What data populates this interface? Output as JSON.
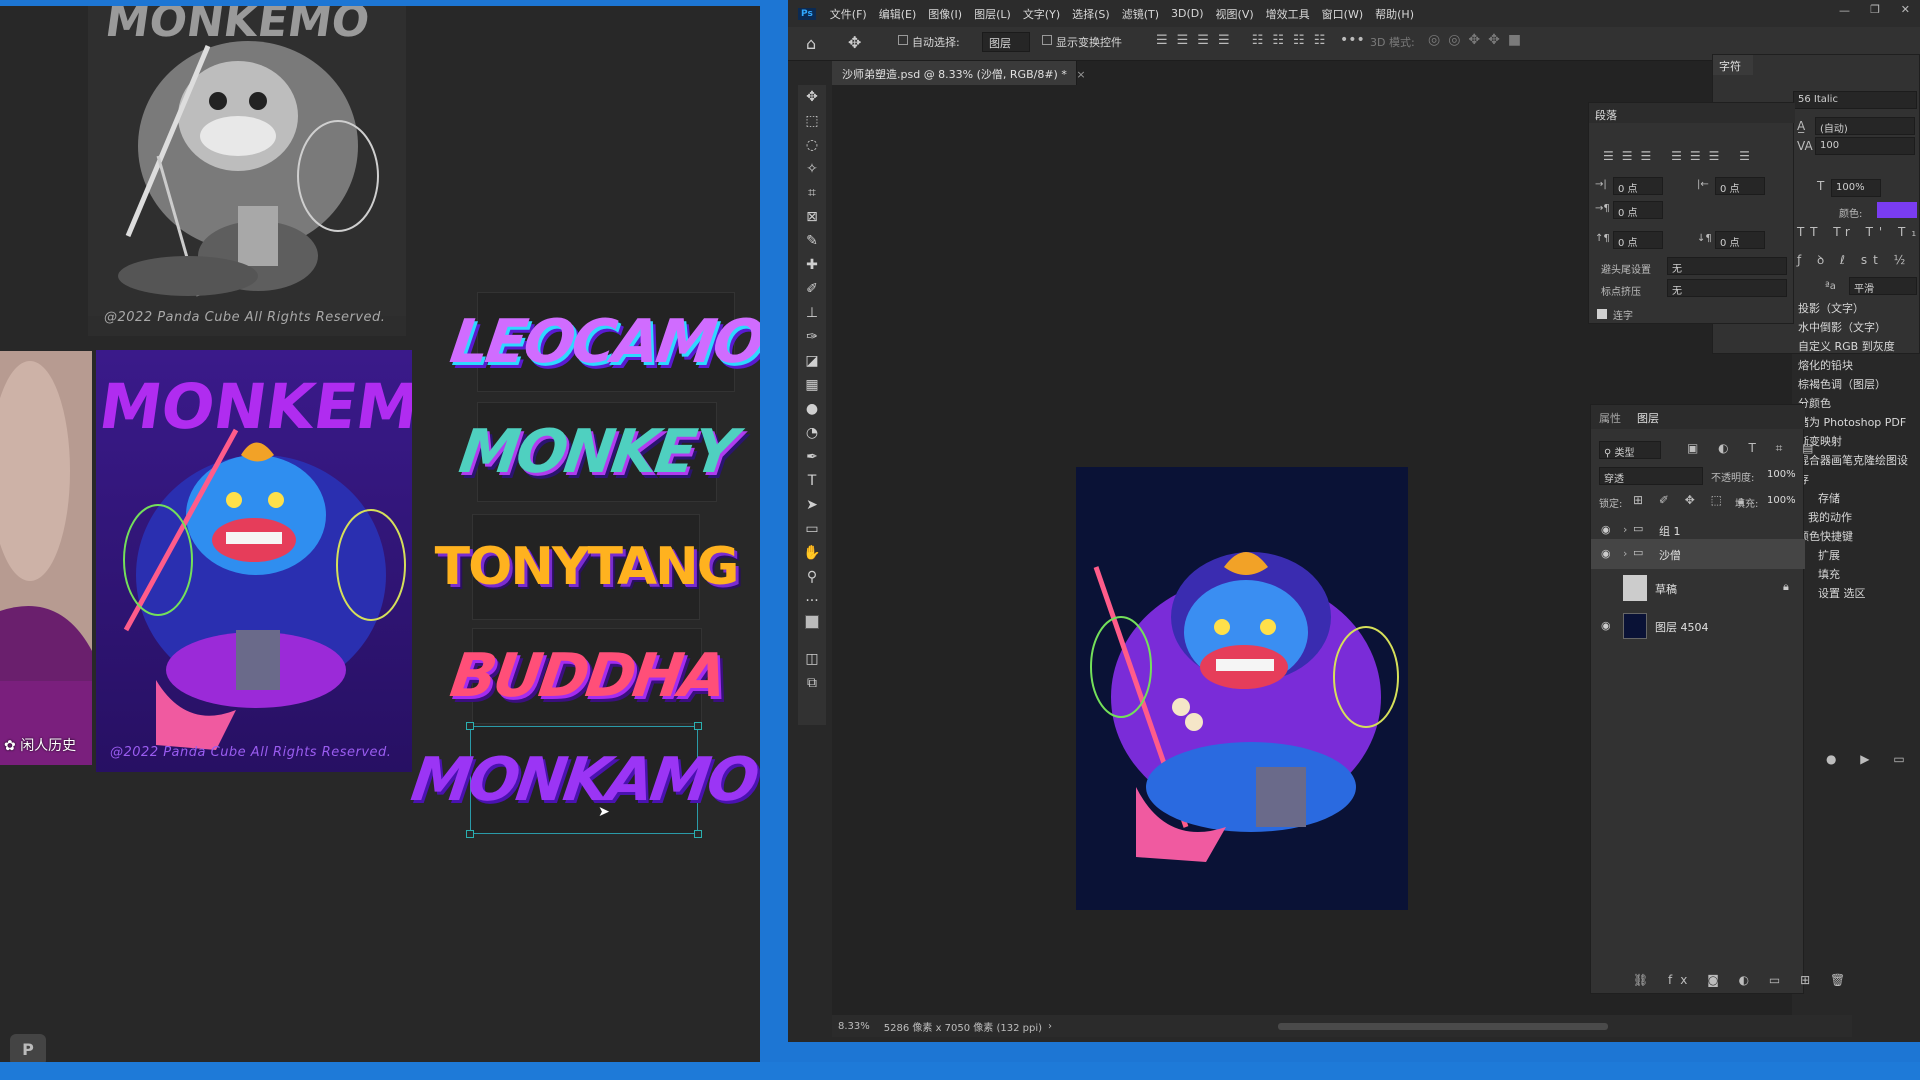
{
  "left_canvas": {
    "watermark_top": "@2022 Panda Cube All Rights Reserved.",
    "watermark_bottom": "@2022 Panda Cube All Rights Reserved.",
    "poster_title": "MONKEMO",
    "wechat_label": "闲人历史",
    "logos": [
      "LEOCAMO",
      "MONKEY",
      "TONYTANG",
      "BUDDHA",
      "MONKAMO"
    ]
  },
  "photoshop": {
    "app_icon": "Ps",
    "menu": [
      "文件(F)",
      "编辑(E)",
      "图像(I)",
      "图层(L)",
      "文字(Y)",
      "选择(S)",
      "滤镜(T)",
      "3D(D)",
      "视图(V)",
      "增效工具",
      "窗口(W)",
      "帮助(H)"
    ],
    "options": {
      "auto_select_label": "自动选择:",
      "auto_select_value": "图层",
      "show_transform_label": "显示变换控件",
      "mode_3d_label": "3D 模式:",
      "more": "•••"
    },
    "doc_tab": "沙师弟塑造.psd @ 8.33% (沙僧, RGB/8#) *",
    "status": {
      "zoom": "8.33%",
      "doc_info": "5286 像素 x 7050 像素 (132 ppi)"
    },
    "char_panel": {
      "tab": "字符",
      "font_style": "56 Italic",
      "leading": "(自动)",
      "tracking": "100",
      "scale": "100%",
      "color_label": "颜色:",
      "color": "#7a3cf2",
      "aa_value": "平滑"
    },
    "para_panel": {
      "tab": "段落",
      "indent_left": "0 点",
      "indent_right": "0 点",
      "indent_first": "0 点",
      "space_before": "0 点",
      "space_after": "0 点",
      "kinsoku_label": "避头尾设置",
      "kinsoku_value": "无",
      "mojikumi_label": "标点挤压",
      "mojikumi_value": "无",
      "hyphen_label": "连字"
    },
    "actions": [
      "投影（文字）",
      "水中倒影（文字）",
      "自定义 RGB 到灰度",
      "熔化的铅块",
      "棕褐色调（图层）",
      "分颜色",
      "储为 Photoshop PDF",
      "渐变映射",
      "混合器画笔克隆绘图设",
      "存",
      "存储",
      "我的动作",
      "颜色快捷键",
      "扩展",
      "填充",
      "设置 选区"
    ],
    "layers_panel": {
      "tab_properties": "属性",
      "tab_layers": "图层",
      "filter_kind": "类型",
      "blend_mode": "穿透",
      "opacity_label": "不透明度:",
      "opacity_value": "100%",
      "lock_label": "锁定:",
      "fill_label": "填充:",
      "fill_value": "100%",
      "layers": [
        {
          "name": "组 1",
          "type": "group",
          "visible": true
        },
        {
          "name": "沙僧",
          "type": "group",
          "visible": true,
          "selected": true
        },
        {
          "name": "草稿",
          "type": "layer",
          "visible": false,
          "locked": true
        },
        {
          "name": "图层 4504",
          "type": "layer",
          "visible": true
        }
      ]
    }
  },
  "colors": {
    "taskbar": "#1d76d4",
    "ps_bg": "#282828",
    "canvas_navy": "#0a1236",
    "selection": "#2a8ea0"
  }
}
